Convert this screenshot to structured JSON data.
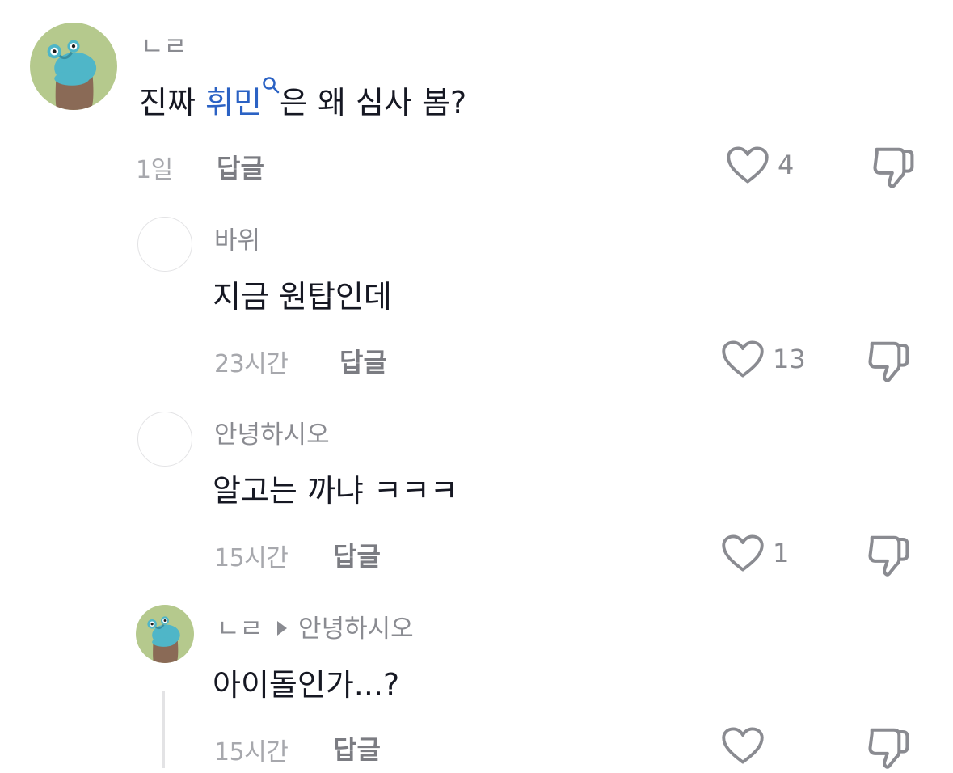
{
  "comments": [
    {
      "username": "ㄴㄹ",
      "text_before": "진짜 ",
      "keyword": "휘민",
      "text_after": "은 왜 심사 봄?",
      "time": "1일",
      "reply_label": "답글",
      "likes": "4",
      "avatar": "frog-sticker-avatar"
    },
    {
      "username": "바위",
      "text": "지금 원탑인데",
      "time": "23시간",
      "reply_label": "답글",
      "likes": "13",
      "avatar": "empty-avatar"
    },
    {
      "username": "안녕하시오",
      "text": "알고는 까냐 ㅋㅋㅋ",
      "time": "15시간",
      "reply_label": "답글",
      "likes": "1",
      "avatar": "empty-avatar"
    },
    {
      "username": "ㄴㄹ",
      "reply_to": "안녕하시오",
      "text": "아이돌인가...?",
      "time": "15시간",
      "reply_label": "답글",
      "likes": "",
      "avatar": "frog-sticker-avatar"
    }
  ],
  "icons": {
    "like": "heart-outline-icon",
    "dislike": "thumbs-down-icon",
    "keyword_search": "search-icon",
    "reply_arrow": "play-arrow-icon"
  },
  "colors": {
    "text": "#161823",
    "muted": "#8a8b91",
    "keyword": "#2b62c4",
    "avatar_bg": "#b5c98d"
  }
}
